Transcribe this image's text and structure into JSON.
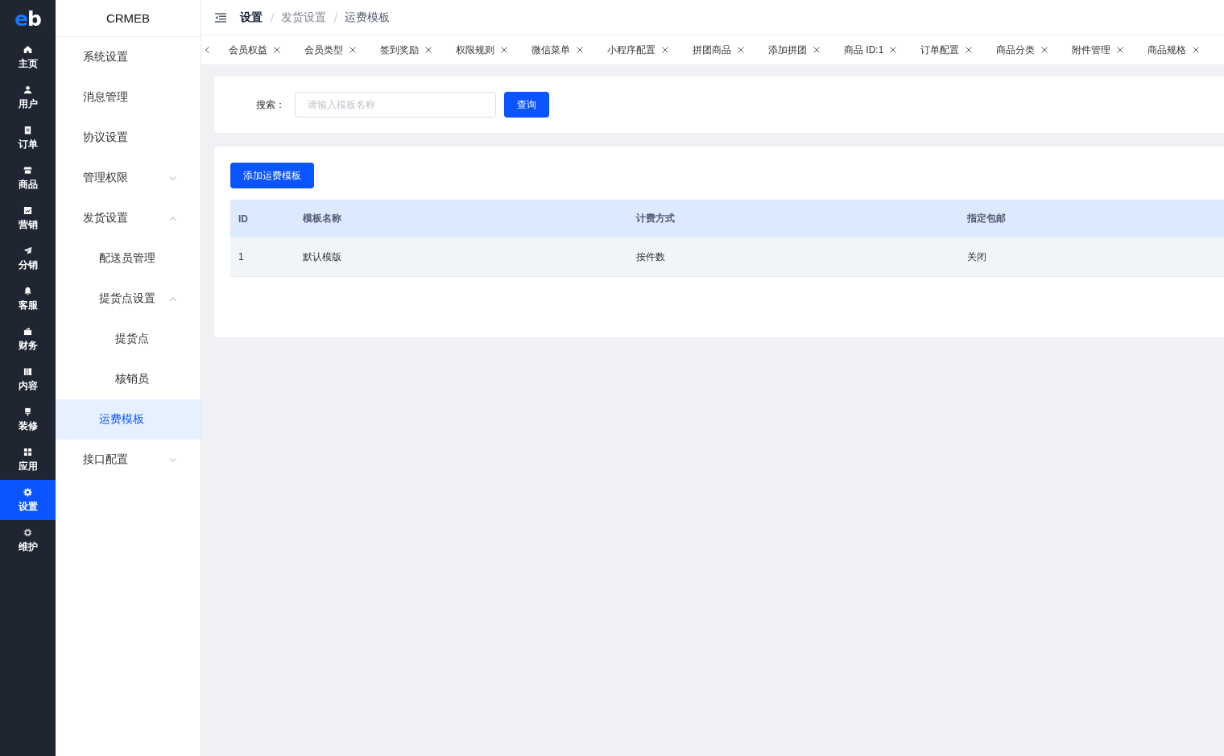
{
  "rail": {
    "logo": "eb",
    "items": [
      {
        "label": "主页",
        "selected": false
      },
      {
        "label": "用户",
        "selected": false
      },
      {
        "label": "订单",
        "selected": false
      },
      {
        "label": "商品",
        "selected": false
      },
      {
        "label": "营销",
        "selected": false
      },
      {
        "label": "分销",
        "selected": false
      },
      {
        "label": "客服",
        "selected": false
      },
      {
        "label": "财务",
        "selected": false
      },
      {
        "label": "内容",
        "selected": false
      },
      {
        "label": "装修",
        "selected": false
      },
      {
        "label": "应用",
        "selected": false
      },
      {
        "label": "设置",
        "selected": true
      },
      {
        "label": "维护",
        "selected": false
      }
    ]
  },
  "sidebar": {
    "title": "CRMEB",
    "menu": [
      {
        "label": "系统设置",
        "selected": false
      },
      {
        "label": "消息管理",
        "selected": false
      },
      {
        "label": "协议设置",
        "selected": false
      },
      {
        "label": "管理权限",
        "selected": false,
        "expanded": false
      },
      {
        "label": "发货设置",
        "selected": false,
        "expanded": true,
        "children": [
          {
            "label": "配送员管理",
            "selected": false
          },
          {
            "label": "提货点设置",
            "selected": false,
            "expanded": true,
            "children": [
              {
                "label": "提货点",
                "selected": false
              },
              {
                "label": "核销员",
                "selected": false
              }
            ]
          },
          {
            "label": "运费模板",
            "selected": true
          }
        ]
      },
      {
        "label": "接口配置",
        "selected": false,
        "expanded": false
      }
    ]
  },
  "header": {
    "breadcrumb": [
      "设置",
      "发货设置",
      "运费模板"
    ]
  },
  "tabs": [
    {
      "label": "会员权益",
      "selected": false
    },
    {
      "label": "会员类型",
      "selected": false
    },
    {
      "label": "签到奖励",
      "selected": false
    },
    {
      "label": "权限规则",
      "selected": false
    },
    {
      "label": "微信菜单",
      "selected": false
    },
    {
      "label": "小程序配置",
      "selected": false
    },
    {
      "label": "拼团商品",
      "selected": false
    },
    {
      "label": "添加拼团",
      "selected": false
    },
    {
      "label": "商品 ID:1",
      "selected": false
    },
    {
      "label": "订单配置",
      "selected": false
    },
    {
      "label": "商品分类",
      "selected": false
    },
    {
      "label": "附件管理",
      "selected": false
    },
    {
      "label": "商品规格",
      "selected": false
    }
  ],
  "search": {
    "label": "搜索：",
    "placeholder": "请输入模板名称",
    "button": "查询"
  },
  "templates": {
    "add_button": "添加运费模板",
    "table": {
      "columns": [
        "ID",
        "模板名称",
        "计费方式",
        "指定包邮"
      ],
      "rows": [
        {
          "cells": [
            "1",
            "默认模版",
            "按件数",
            "关闭"
          ],
          "hovered": true
        }
      ]
    }
  }
}
